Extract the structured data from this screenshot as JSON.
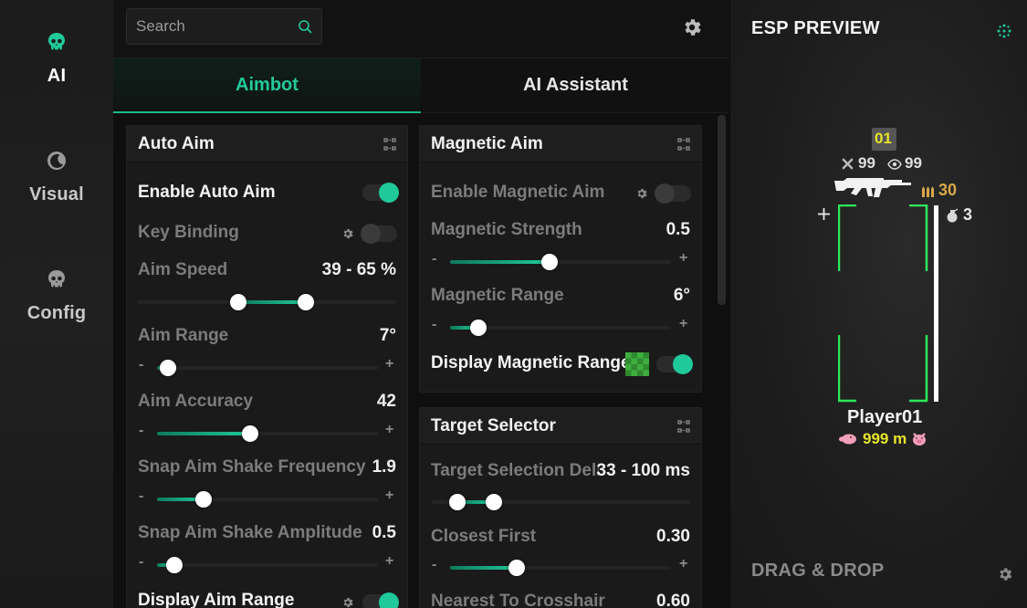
{
  "nav": {
    "items": [
      {
        "label": "AI",
        "icon": "skull-icon",
        "active": true
      },
      {
        "label": "Visual",
        "icon": "moon-icon",
        "active": false
      },
      {
        "label": "Config",
        "icon": "skull-icon",
        "active": false
      }
    ]
  },
  "search": {
    "placeholder": "Search"
  },
  "tabs": [
    {
      "label": "Aimbot",
      "active": true
    },
    {
      "label": "AI Assistant",
      "active": false
    }
  ],
  "auto_aim": {
    "title": "Auto Aim",
    "enable_label": "Enable Auto Aim",
    "key_binding_label": "Key Binding",
    "aim_speed": {
      "label": "Aim Speed",
      "value": "39 - 65 %",
      "range": [
        0.39,
        0.65
      ]
    },
    "aim_range": {
      "label": "Aim Range",
      "value": "7°",
      "level": 0.05
    },
    "aim_accuracy": {
      "label": "Aim Accuracy",
      "value": "42",
      "level": 0.42
    },
    "shake_freq": {
      "label": "Snap Aim Shake Frequency",
      "value": "1.9",
      "level": 0.21
    },
    "shake_amp": {
      "label": "Snap Aim Shake Amplitude",
      "value": "0.5",
      "level": 0.08
    },
    "display_range_label": "Display Aim Range"
  },
  "magnetic_aim": {
    "title": "Magnetic Aim",
    "enable_label": "Enable Magnetic Aim",
    "strength": {
      "label": "Magnetic Strength",
      "value": "0.5",
      "level": 0.45
    },
    "range": {
      "label": "Magnetic Range",
      "value": "6°",
      "level": 0.13
    },
    "display_label": "Display Magnetic Range"
  },
  "target_selector": {
    "title": "Target Selector",
    "delay": {
      "label": "Target Selection Delay",
      "value": "33 - 100 ms",
      "range": [
        0.1,
        0.24
      ]
    },
    "closest": {
      "label": "Closest First",
      "value": "0.30",
      "level": 0.3
    },
    "nearest": {
      "label": "Nearest To Crosshair",
      "value": "0.60"
    }
  },
  "symbols": {
    "minus": "-",
    "plus": "+"
  },
  "esp": {
    "title": "ESP PREVIEW",
    "rank": "01",
    "kills": "99",
    "views": "99",
    "ammo": "30",
    "grenades": "3",
    "player_name": "Player01",
    "distance": "999 m",
    "drag_drop": "DRAG & DROP",
    "health_level": 1.0
  },
  "colors": {
    "accent": "#1fc99a",
    "box_green": "#2ee85a",
    "esp_yellow": "#e8e42a",
    "ammo_gold": "#d9a84a"
  }
}
